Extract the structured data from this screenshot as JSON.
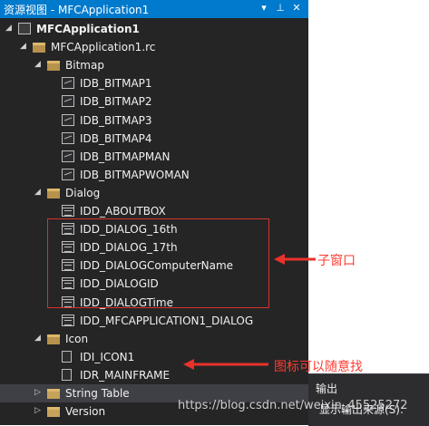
{
  "panel": {
    "title": "资源视图 - MFCApplication1",
    "controls": {
      "dropdown": "▾",
      "pin": "⊥",
      "close": "✕"
    }
  },
  "tree": [
    {
      "label": "MFCApplication1",
      "indent": 0,
      "arrow": "◢",
      "icon": "project-icon",
      "bold": true
    },
    {
      "label": "MFCApplication1.rc",
      "indent": 1,
      "arrow": "◢",
      "icon": "folder-open-icon"
    },
    {
      "label": "Bitmap",
      "indent": 2,
      "arrow": "◢",
      "icon": "folder-open-icon"
    },
    {
      "label": "IDB_BITMAP1",
      "indent": 3,
      "icon": "bitmap-icon"
    },
    {
      "label": "IDB_BITMAP2",
      "indent": 3,
      "icon": "bitmap-icon"
    },
    {
      "label": "IDB_BITMAP3",
      "indent": 3,
      "icon": "bitmap-icon"
    },
    {
      "label": "IDB_BITMAP4",
      "indent": 3,
      "icon": "bitmap-icon"
    },
    {
      "label": "IDB_BITMAPMAN",
      "indent": 3,
      "icon": "bitmap-icon"
    },
    {
      "label": "IDB_BITMAPWOMAN",
      "indent": 3,
      "icon": "bitmap-icon"
    },
    {
      "label": "Dialog",
      "indent": 2,
      "arrow": "◢",
      "icon": "folder-open-icon"
    },
    {
      "label": "IDD_ABOUTBOX",
      "indent": 3,
      "icon": "dialog-icon"
    },
    {
      "label": "IDD_DIALOG_16th",
      "indent": 3,
      "icon": "dialog-icon"
    },
    {
      "label": "IDD_DIALOG_17th",
      "indent": 3,
      "icon": "dialog-icon"
    },
    {
      "label": "IDD_DIALOGComputerName",
      "indent": 3,
      "icon": "dialog-icon"
    },
    {
      "label": "IDD_DIALOGID",
      "indent": 3,
      "icon": "dialog-icon"
    },
    {
      "label": "IDD_DIALOGTime",
      "indent": 3,
      "icon": "dialog-icon"
    },
    {
      "label": "IDD_MFCAPPLICATION1_DIALOG",
      "indent": 3,
      "icon": "dialog-icon"
    },
    {
      "label": "Icon",
      "indent": 2,
      "arrow": "◢",
      "icon": "folder-open-icon"
    },
    {
      "label": "IDI_ICON1",
      "indent": 3,
      "icon": "icon-file-icon"
    },
    {
      "label": "IDR_MAINFRAME",
      "indent": 3,
      "icon": "icon-file-icon"
    },
    {
      "label": "String Table",
      "indent": 2,
      "arrow": "▷",
      "icon": "folder-closed-icon",
      "selected": true
    },
    {
      "label": "Version",
      "indent": 2,
      "arrow": "▷",
      "icon": "folder-closed-icon"
    }
  ],
  "annotations": {
    "subwindow": "子窗口",
    "icons_note": "图标可以随意找"
  },
  "output_panel": {
    "title": "输出",
    "source_label": "显示输出来源(S):"
  },
  "watermark": "https://blog.csdn.net/weixin_45525272",
  "colors": {
    "panel_bg": "#252526",
    "titlebar_bg": "#007acc",
    "annotation_red": "#ff3b30"
  }
}
